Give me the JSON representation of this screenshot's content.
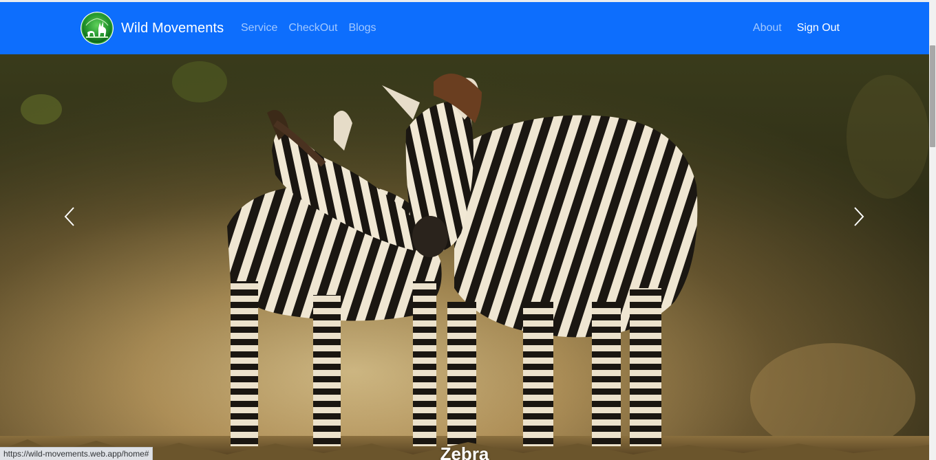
{
  "navbar": {
    "brand_name": "Wild Movements",
    "brand_logo_icon": "wildlife-globe-logo",
    "links_left": [
      "Service",
      "CheckOut",
      "Blogs"
    ],
    "links_right": [
      "About",
      "Sign Out"
    ],
    "bg_color": "#0d6efd"
  },
  "carousel": {
    "slide_caption": "Zebra",
    "prev_icon": "chevron-left-icon",
    "next_icon": "chevron-right-icon"
  },
  "status_bar": {
    "url": "https://wild-movements.web.app/home#"
  }
}
